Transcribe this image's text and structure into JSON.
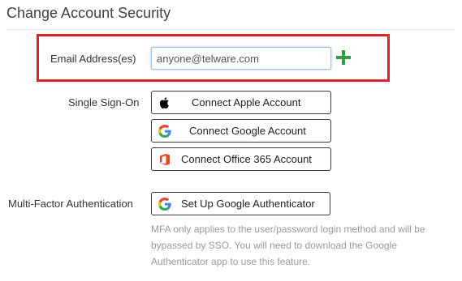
{
  "page": {
    "title": "Change Account Security"
  },
  "email": {
    "label": "Email Address(es)",
    "value": "anyone@telware.com",
    "add_icon": "plus-icon",
    "accent_color": "#2ea043"
  },
  "highlight": {
    "color": "#d9262e"
  },
  "sso": {
    "label": "Single Sign-On",
    "buttons": [
      {
        "label": "Connect Apple Account",
        "icon": "apple-icon"
      },
      {
        "label": "Connect Google Account",
        "icon": "google-icon"
      },
      {
        "label": "Connect Office 365 Account",
        "icon": "office-365-icon"
      }
    ]
  },
  "mfa": {
    "label": "Multi-Factor Authentication",
    "button": {
      "label": "Set Up Google Authenticator",
      "icon": "google-icon"
    },
    "help_text": "MFA only applies to the user/password login method and will be bypassed by SSO. You will need to download the Google Authenticator app to use this feature."
  }
}
